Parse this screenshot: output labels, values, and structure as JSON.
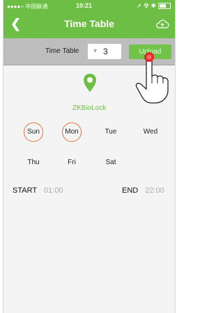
{
  "status_bar": {
    "carrier": "●●●●○ 中国联通",
    "time": "10:21",
    "icons": "➚ ☢ ✱"
  },
  "nav": {
    "title": "Time Table",
    "back_icon": "chevron-left-icon",
    "cloud_icon": "cloud-upload-icon"
  },
  "selector": {
    "label": "Time Table",
    "value": "3",
    "button_label": "Upload"
  },
  "lock": {
    "name": "ZKBioLock",
    "icon": "location-pin-icon"
  },
  "days": [
    {
      "label": "Sun",
      "selected": true
    },
    {
      "label": "Mon",
      "selected": true
    },
    {
      "label": "Tue",
      "selected": false
    },
    {
      "label": "Wed",
      "selected": false
    },
    {
      "label": "Thu",
      "selected": false
    },
    {
      "label": "Fri",
      "selected": false
    },
    {
      "label": "Sat",
      "selected": false
    }
  ],
  "start": {
    "label": "START",
    "value": "01:00"
  },
  "end": {
    "label": "END",
    "value": "22:00"
  },
  "colors": {
    "accent": "#6cbe45",
    "selected_ring": "#f0703c",
    "header_bar": "#b9b9b9"
  }
}
